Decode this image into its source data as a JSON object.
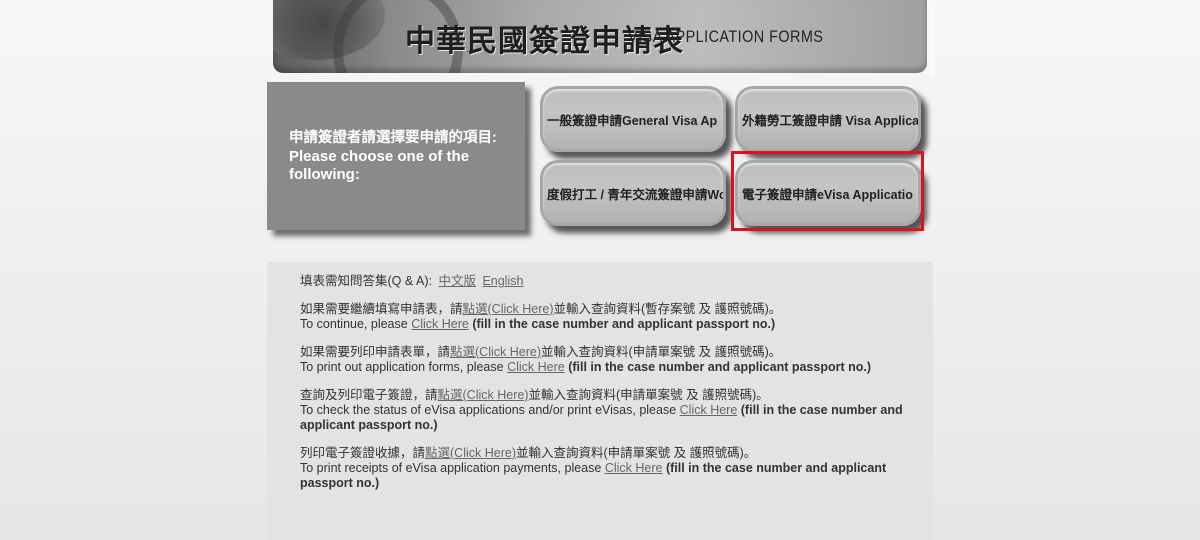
{
  "banner": {
    "title_cn": "中華民國簽證申請表",
    "title_en": "VISA APPLICATION FORMS"
  },
  "prompt": {
    "cn": "申請簽證者請選擇要申請的項目:",
    "en": "Please choose one of the following:"
  },
  "buttons": [
    {
      "label": "一般簽證申請General Visa Ap"
    },
    {
      "label": "外籍勞工簽證申請 Visa Applica"
    },
    {
      "label": "度假打工 / 青年交流簽證申請Wo"
    },
    {
      "label": "電子簽證申請eVisa Applicatio"
    }
  ],
  "info": {
    "qa_label": "填表需知問答集(Q & A):",
    "qa_cn": "中文版",
    "qa_en": "English",
    "blocks": [
      {
        "cn_pre": "如果需要繼續填寫申請表，請",
        "cn_link": "點選(Click Here)",
        "cn_post": "並輸入查詢資料(暫存案號 及 護照號碼)。",
        "en_pre": "To continue, please ",
        "en_link": "Click Here",
        "en_post": " (fill in the case number and applicant passport no.)"
      },
      {
        "cn_pre": "如果需要列印申請表單，請",
        "cn_link": "點選(Click Here)",
        "cn_post": "並輸入查詢資料(申請單案號 及 護照號碼)。",
        "en_pre": "To print out application forms, please ",
        "en_link": "Click Here",
        "en_post": " (fill in the case number and applicant passport no.)"
      },
      {
        "cn_pre": "查詢及列印電子簽證，請",
        "cn_link": "點選(Click Here)",
        "cn_post": "並輸入查詢資料(申請單案號 及 護照號碼)。",
        "en_pre": "To check the status of eVisa applications and/or print eVisas, please ",
        "en_link": "Click Here",
        "en_post": " (fill in the case number and applicant passport no.)"
      },
      {
        "cn_pre": "列印電子簽證收據，請",
        "cn_link": "點選(Click Here)",
        "cn_post": "並輸入查詢資料(申請單案號 及 護照號碼)。",
        "en_pre": "To print receipts of eVisa application payments, please ",
        "en_link": "Click Here",
        "en_post": " (fill in the case number and applicant passport no.)"
      }
    ]
  },
  "colors": {
    "highlight": "#d9141b",
    "panel": "#8a8a8a",
    "button": "#bdbdbd"
  }
}
